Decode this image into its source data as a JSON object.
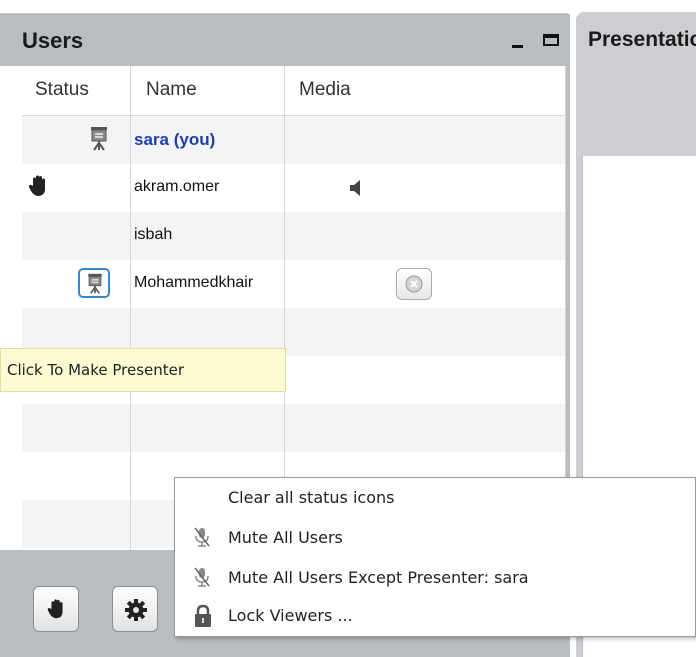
{
  "users_panel": {
    "title": "Users",
    "columns": {
      "status": "Status",
      "name": "Name",
      "media": "Media"
    },
    "users": [
      {
        "name": "sara (you)",
        "status": "presenter",
        "media": ""
      },
      {
        "name": "akram.omer",
        "status": "raised-hand",
        "media": "speaker"
      },
      {
        "name": "isbah",
        "status": "",
        "media": ""
      },
      {
        "name": "Mohammedkhair",
        "status": "make-presenter-button",
        "media": "kick-button"
      }
    ],
    "tooltip": "Click To Make Presenter"
  },
  "presentation_panel": {
    "title": "Presentation"
  },
  "context_menu": {
    "items": [
      {
        "label": "Clear all status icons",
        "icon": ""
      },
      {
        "label": "Mute All Users",
        "icon": "microphone-muted-icon"
      },
      {
        "label": "Mute All Users Except Presenter: sara",
        "icon": "microphone-muted-icon"
      },
      {
        "label": "Lock Viewers ...",
        "icon": "lock-icon"
      }
    ]
  },
  "colors": {
    "header_bg": "#b9bcc0",
    "current_user": "#1f3fb0",
    "tooltip_bg": "#fdfbd2",
    "presenter_button_border": "#3a86c8"
  }
}
